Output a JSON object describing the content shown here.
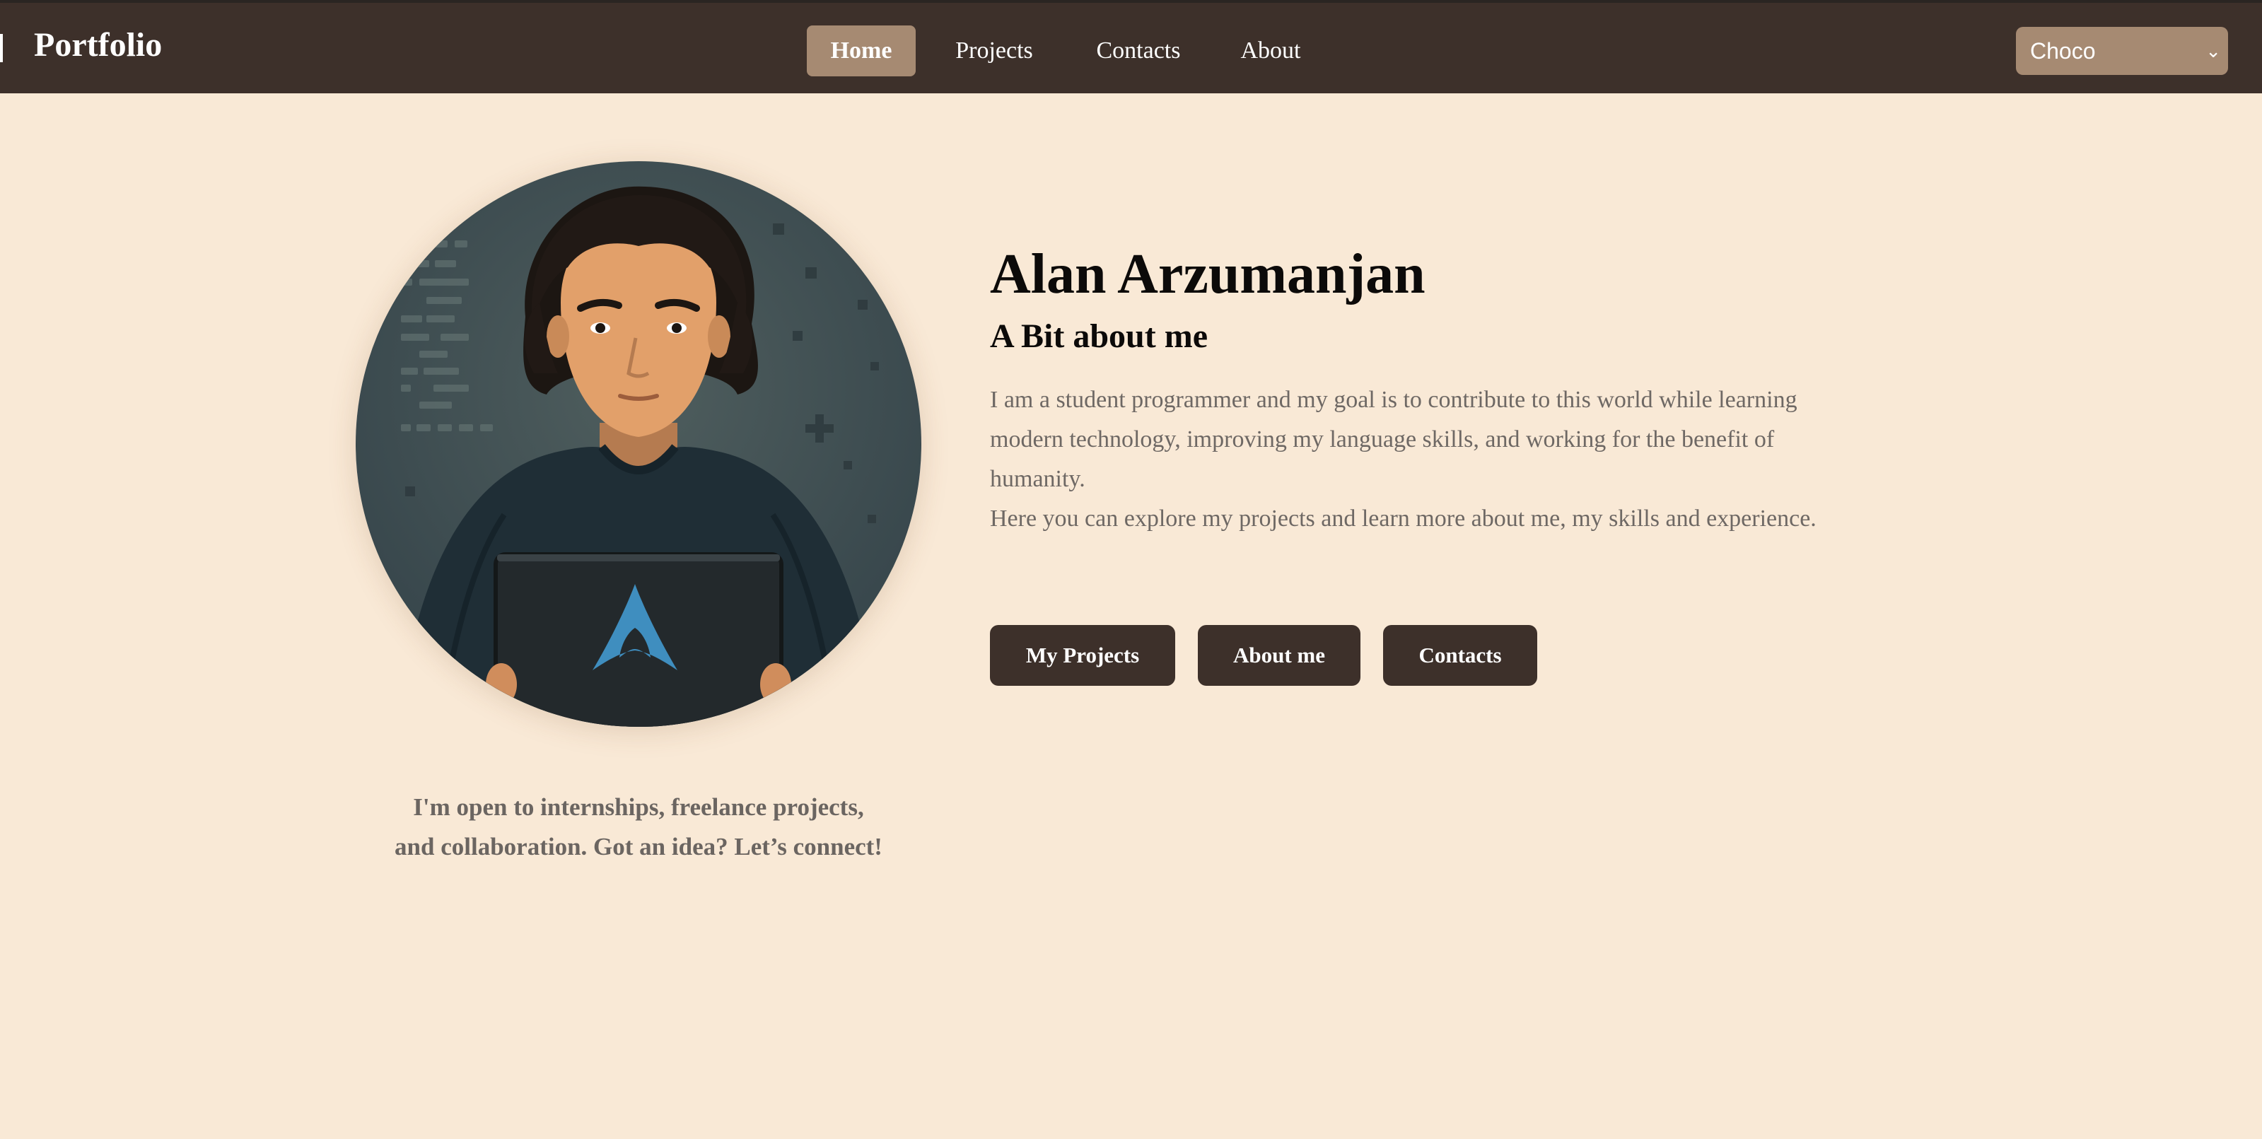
{
  "header": {
    "brand": "Portfolio",
    "nav": [
      {
        "label": "Home",
        "active": true
      },
      {
        "label": "Projects",
        "active": false
      },
      {
        "label": "Contacts",
        "active": false
      },
      {
        "label": "About",
        "active": false
      }
    ],
    "theme_select": {
      "value": "Choco"
    }
  },
  "hero": {
    "name": "Alan Arzumanjan",
    "subtitle": "A Bit about me",
    "bio": [
      "I am a student programmer and my goal is to contribute to this world while learning modern technology, improving my language skills, and working for the benefit of humanity.",
      "Here you can explore my projects and learn more about me, my skills and experience."
    ],
    "buttons": [
      {
        "label": "My Projects"
      },
      {
        "label": "About me"
      },
      {
        "label": "Contacts"
      }
    ],
    "caption_lines": [
      "I'm open to internships, freelance projects,",
      "and collaboration. Got an idea? Let’s connect!"
    ]
  },
  "colors": {
    "page_background": "#f9e9d6",
    "header_background": "#3d302a",
    "accent": "#a68a72",
    "button_background": "#3d302a",
    "body_text": "#6e6864"
  },
  "icons": {
    "avatar": "developer-with-laptop-illustration",
    "laptop_logo": "arch-linux-logo-icon",
    "select_chevron": "chevron-down-icon"
  }
}
